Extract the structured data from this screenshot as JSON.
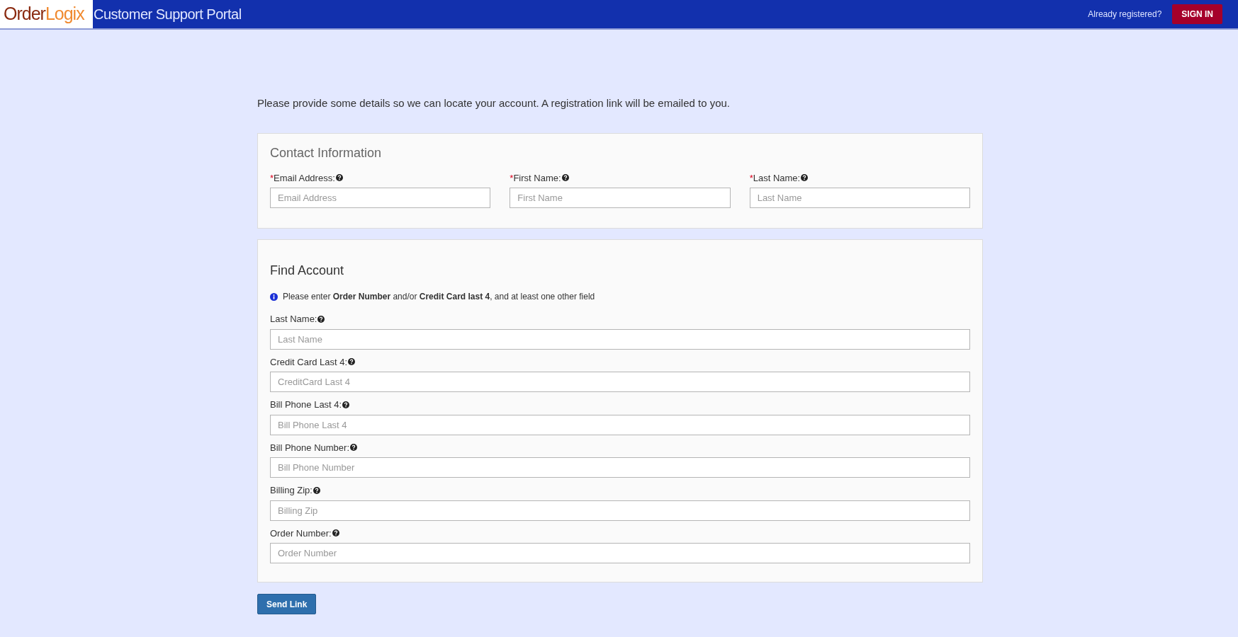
{
  "header": {
    "logo": {
      "part_1": "Order",
      "part_2": "Logix"
    },
    "title": "Customer Support Portal",
    "prompt": "Already registered?",
    "sign_in": "SIGN IN"
  },
  "intro": "Please provide some details so we can locate your account. A registration link will be emailed to you.",
  "required_marker": "*",
  "contact": {
    "title": "Contact Information",
    "fields": [
      {
        "label": "Email Address:",
        "placeholder": "Email Address",
        "required": true
      },
      {
        "label": "First Name:",
        "placeholder": "First Name",
        "required": true
      },
      {
        "label": "Last Name:",
        "placeholder": "Last Name",
        "required": true
      }
    ]
  },
  "find_account": {
    "title": "Find Account",
    "info": "Please enter **Order Number** and/or **Credit Card last 4**, and at least one other field",
    "fields": [
      {
        "label": "Last Name:",
        "placeholder": "Last Name",
        "required": false
      },
      {
        "label": "Credit Card Last 4:",
        "placeholder": "CreditCard Last 4",
        "required": false
      },
      {
        "label": "Bill Phone Last 4:",
        "placeholder": "Bill Phone Last 4",
        "required": false
      },
      {
        "label": "Bill Phone Number:",
        "placeholder": "Bill Phone Number",
        "required": false
      },
      {
        "label": "Billing Zip:",
        "placeholder": "Billing Zip",
        "required": false
      },
      {
        "label": "Order Number:",
        "placeholder": "Order Number",
        "required": false
      }
    ]
  },
  "submit": "Send Link"
}
